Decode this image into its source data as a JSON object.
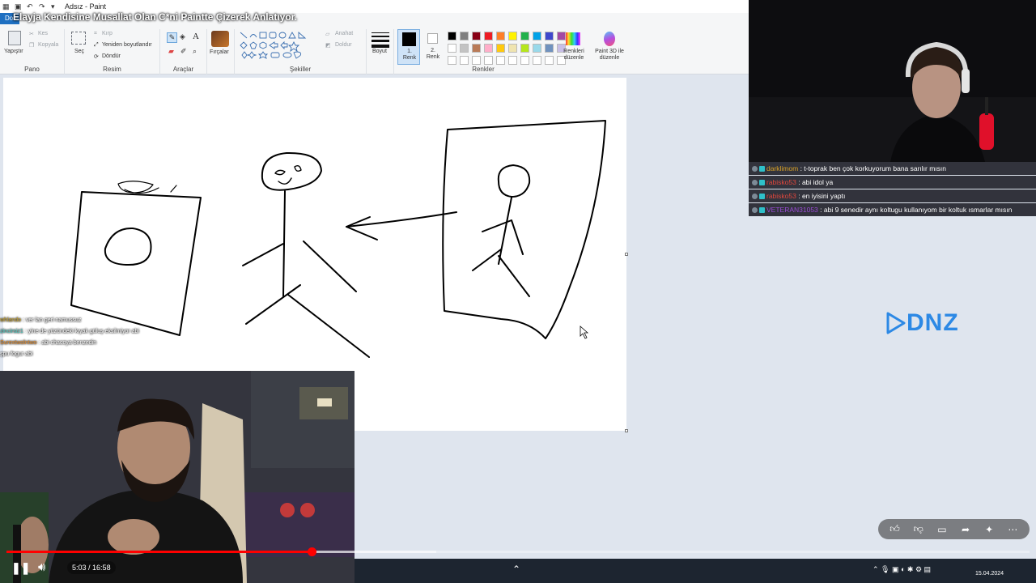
{
  "window": {
    "title": "Adsız - Paint",
    "file_tab": "Do"
  },
  "video": {
    "title": "Elayja Kendisine Musallat Olan C*ni Paintte Çizerek Anlatıyor."
  },
  "ribbon": {
    "pano": {
      "label": "Pano",
      "paste": "Yapıştır",
      "cut": "Kes",
      "copy": "Kopyala"
    },
    "resim": {
      "label": "Resim",
      "select": "Seç",
      "crop": "Kırp",
      "resize": "Yeniden boyutlandır",
      "rotate": "Döndür"
    },
    "araclar": {
      "label": "Araçlar"
    },
    "fircalar": "Fırçalar",
    "sekiller": {
      "label": "Şekiller",
      "outline": "Anahat",
      "fill": "Doldur"
    },
    "boyut": "Boyut",
    "renkler": {
      "label": "Renkler",
      "color1": "1. Renk",
      "color2": "2. Renk",
      "edit": "Renkleri düzenle",
      "paint3d": "Paint 3D ile düzenle"
    },
    "palette_row1": [
      "#000000",
      "#7f7f7f",
      "#880015",
      "#ed1c24",
      "#ff7f27",
      "#fff200",
      "#22b14c",
      "#00a2e8",
      "#3f48cc",
      "#a349a4"
    ],
    "palette_row2": [
      "#ffffff",
      "#c3c3c3",
      "#b97a57",
      "#ffaec9",
      "#ffc90e",
      "#efe4b0",
      "#b5e61d",
      "#99d9ea",
      "#7092be",
      "#c8bfe7"
    ]
  },
  "left_chat": [
    {
      "user": "whlando",
      "msg": " : ver lan geri namussuz",
      "color": "#c9a227"
    },
    {
      "user": "zincirsiz1",
      "msg": " : yine de yüzündeki kıyak güluş eksilmiyor abi",
      "color": "#4cc9c0"
    },
    {
      "user": "Surextwolntwo",
      "msg": " : abi chacoya benzedin",
      "color": "#e0892a"
    },
    {
      "user": "",
      "msg": "şpu fogur abi",
      "color": "#ffffff"
    }
  ],
  "right_chat": [
    {
      "user": "darklimom",
      "msg": ": t-toprak ben çok korkuyorum bana sarılır mısın",
      "color": "#d9a227"
    },
    {
      "user": "rabisko53",
      "msg": ": abi idol ya",
      "color": "#e0473c"
    },
    {
      "user": "rabisko53",
      "msg": ": en iyisini yaptı",
      "color": "#e0473c"
    },
    {
      "user": "VETERAN31053",
      "msg": ": abi 9 senedir aynı koltugu kullanıyom bir koltuk ısmarlar mısın",
      "color": "#9b4bd6"
    }
  ],
  "sponsor": {
    "logo_text": "DNZ"
  },
  "player": {
    "time_current": "5:03",
    "time_total": "16:58",
    "time_sep": " / ",
    "progress_fraction": 0.298,
    "buffered_fraction": 0.42
  },
  "taskbar": {
    "date": "15.04.2024"
  },
  "colors": {
    "accent": "#1e6fc1",
    "progress": "#ff0000",
    "dnz": "#2d89e5"
  }
}
